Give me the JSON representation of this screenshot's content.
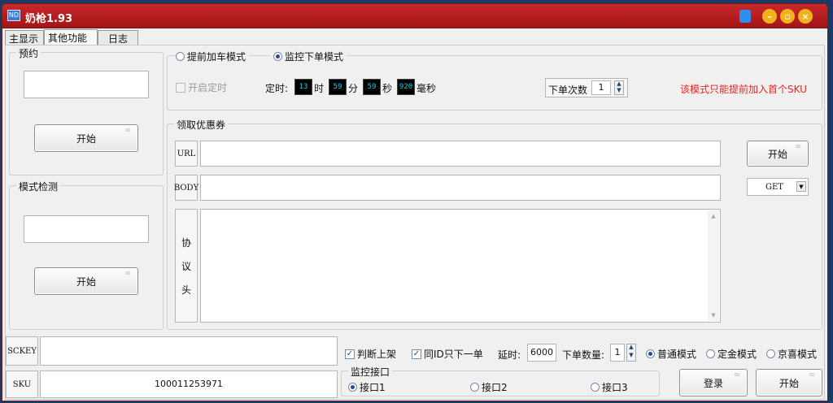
{
  "window": {
    "title": "奶枪1.93",
    "icon": "app-icon"
  },
  "tabs": [
    {
      "label": "主显示"
    },
    {
      "label": "其他功能",
      "active": true
    },
    {
      "label": "日志"
    }
  ],
  "reserve": {
    "title": "预约",
    "input": "",
    "start": "开始"
  },
  "mode_detect": {
    "title": "模式检测",
    "input": "",
    "start": "开始"
  },
  "modes": {
    "option1": "提前加车模式",
    "option2": "监控下单模式",
    "selected": "监控下单模式"
  },
  "timer": {
    "enable_label": "开启定时",
    "label": "定时:",
    "hour": "13",
    "hour_unit": "时",
    "minute": "59",
    "minute_unit": "分",
    "second": "59",
    "second_unit": "秒",
    "ms": "920",
    "ms_unit": "毫秒"
  },
  "order_count": {
    "label": "下单次数",
    "value": "1"
  },
  "warning": "该模式只能提前加入首个SKU",
  "coupon": {
    "title": "领取优惠券",
    "url_label": "URL",
    "url_value": "",
    "body_label": "BODY",
    "body_value": "",
    "header_label_1": "协",
    "header_label_2": "议",
    "header_label_3": "头",
    "start": "开始",
    "method": "GET"
  },
  "bottom": {
    "sckey_label": "SCKEY",
    "sckey_value": "",
    "sku_label": "SKU",
    "sku_value": "100011253971",
    "check_shelf": "判断上架",
    "check_same_id": "同ID只下一单",
    "delay_label": "延时:",
    "delay_value": "6000",
    "qty_label": "下单数量:",
    "qty_value": "1",
    "mode_normal": "普通模式",
    "mode_deposit": "定金模式",
    "mode_jx": "京喜模式",
    "monitor_title": "监控接口",
    "iface1": "接口1",
    "iface2": "接口2",
    "iface3": "接口3",
    "login": "登录",
    "start": "开始"
  },
  "colors": {
    "titlebar": "#b31d1f",
    "warning": "#e22222",
    "digit_text": "#18d0e8"
  }
}
